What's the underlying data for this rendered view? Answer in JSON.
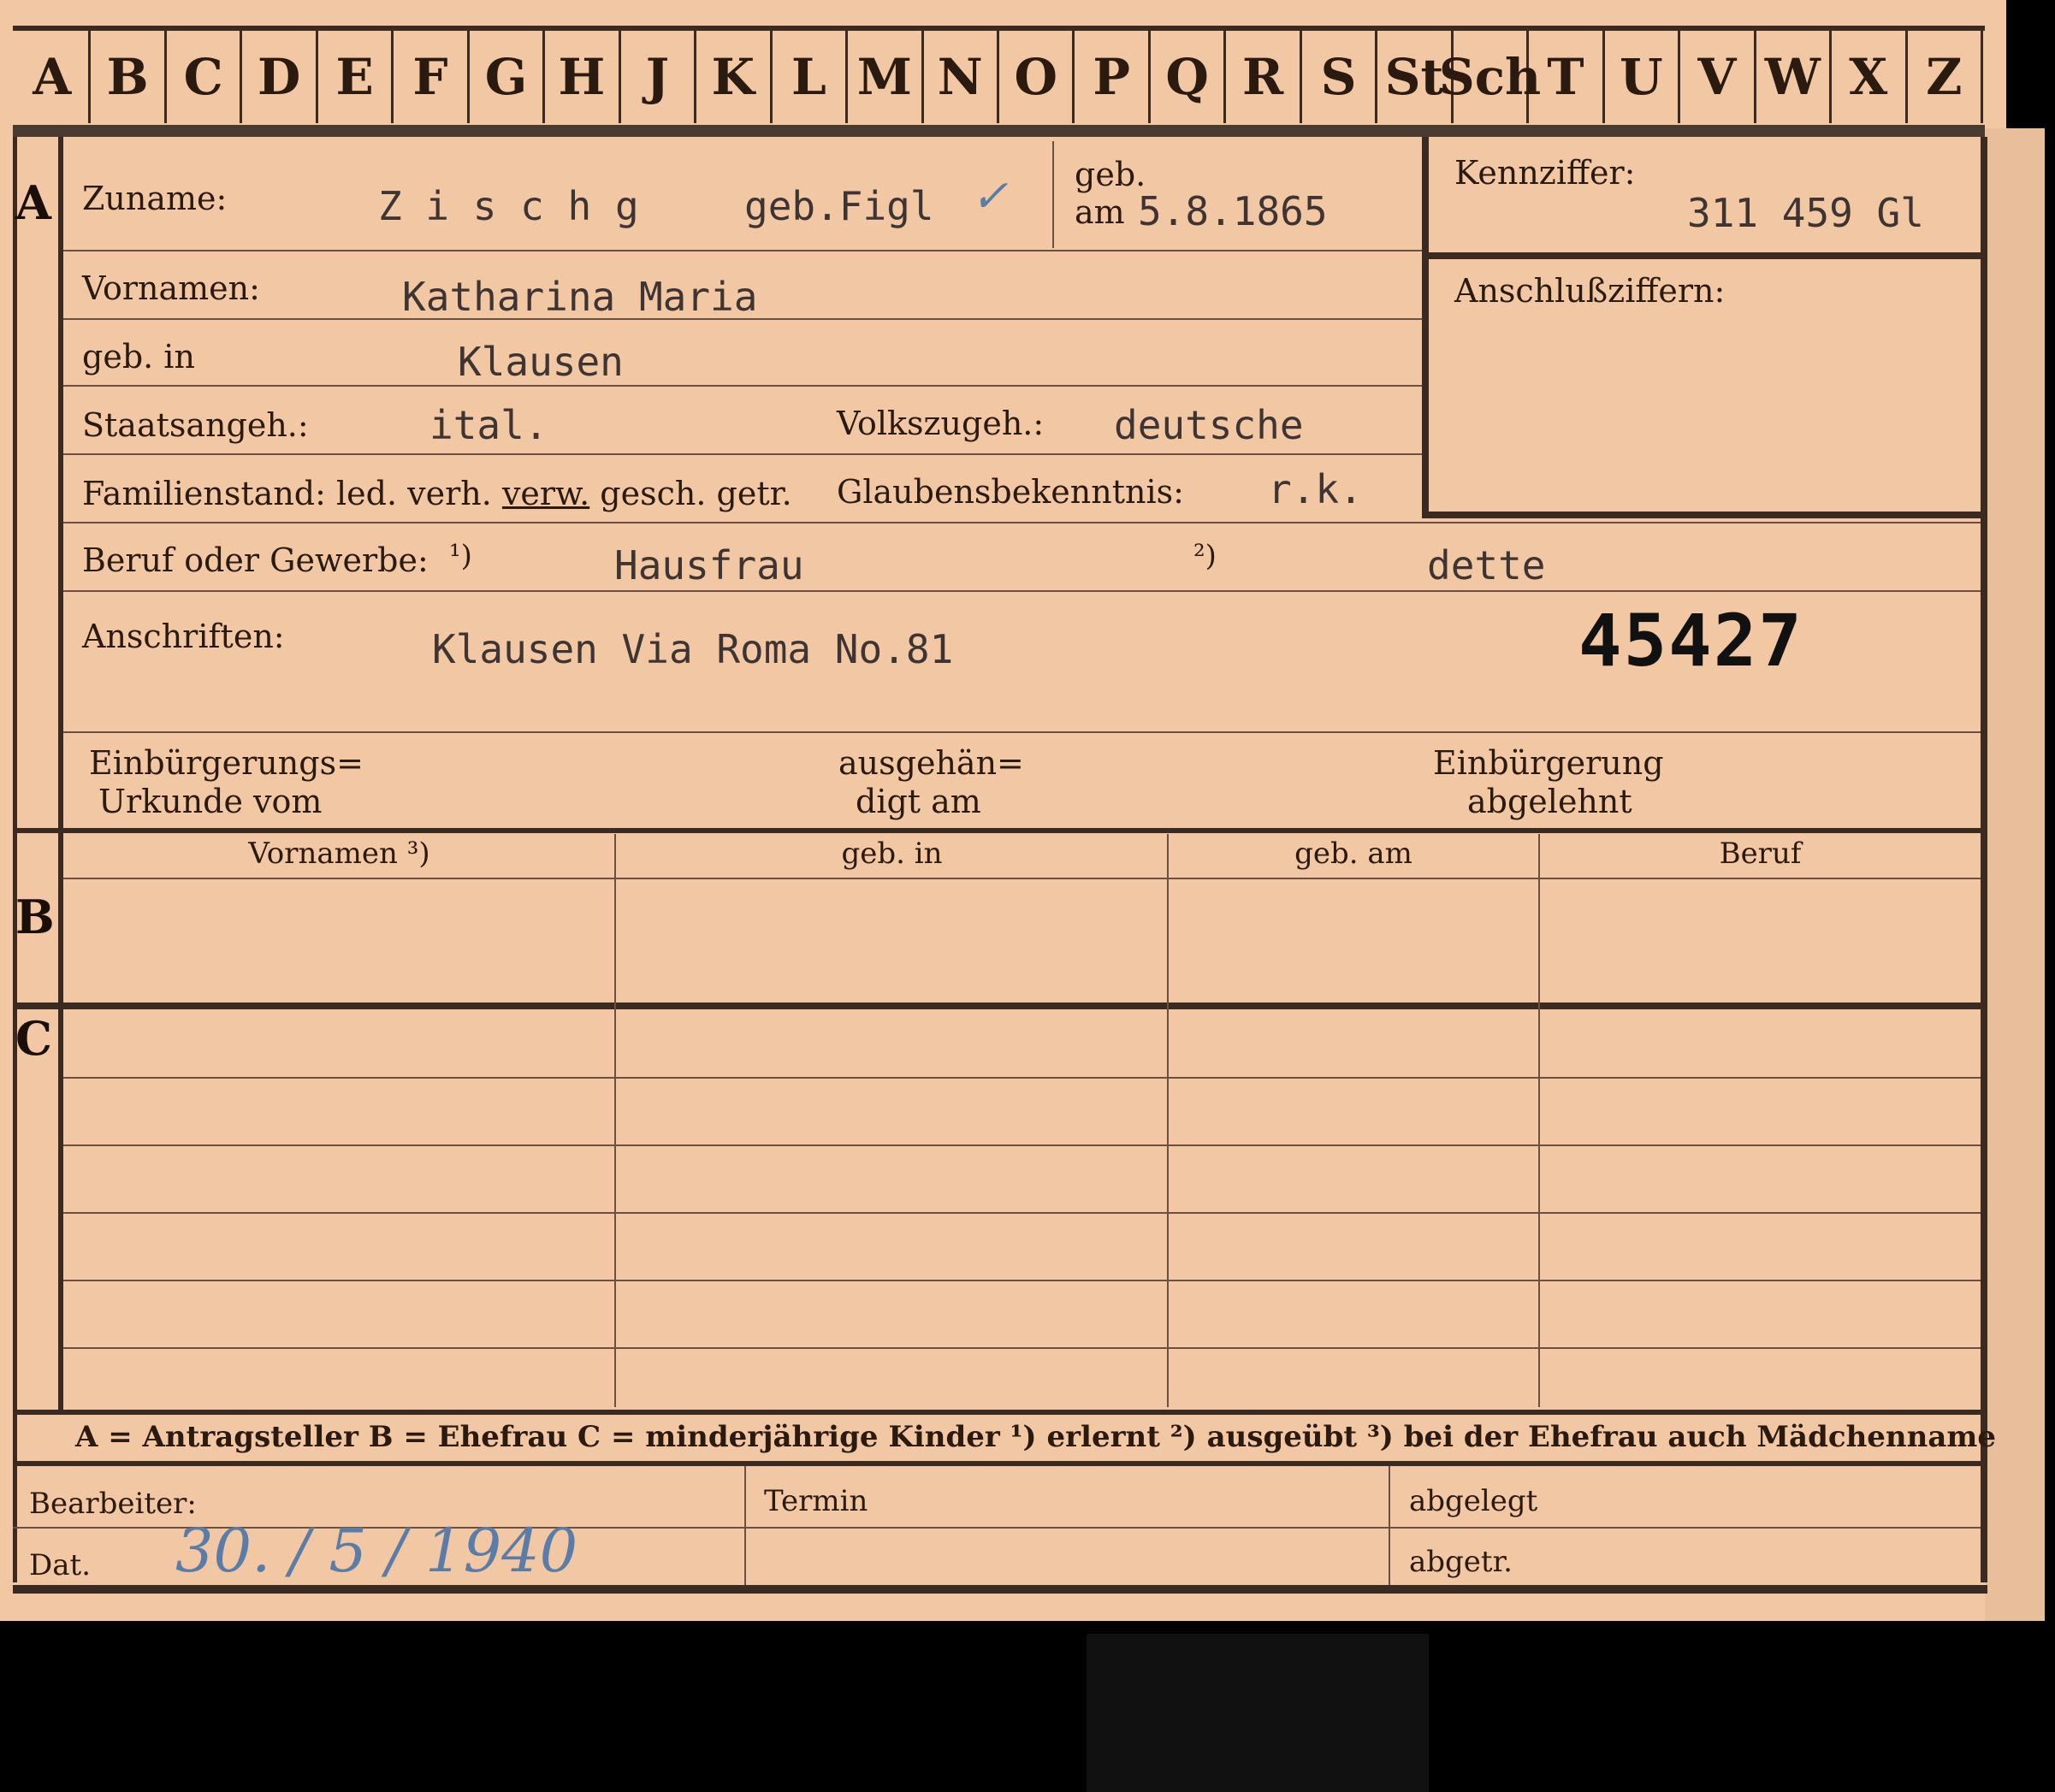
{
  "alphabet_tabs": [
    "A",
    "B",
    "C",
    "D",
    "E",
    "F",
    "G",
    "H",
    "J",
    "K",
    "L",
    "M",
    "N",
    "O",
    "P",
    "Q",
    "R",
    "S",
    "St",
    "Sch",
    "T",
    "U",
    "V",
    "W",
    "X",
    "Z"
  ],
  "sections": {
    "a": "A",
    "b": "B",
    "c": "C"
  },
  "labels": {
    "zuname": "Zuname:",
    "geb": "geb.",
    "am": "am",
    "kennziffer": "Kennziffer:",
    "anschlussziffern": "Anschlußziffern:",
    "vornamen": "Vornamen:",
    "geb_in": "geb. in",
    "staatsangeh": "Staatsangeh.:",
    "volkszugeh": "Volkszugeh.:",
    "familienstand": "Familienstand:",
    "fs_led": "led.",
    "fs_verh": "verh.",
    "fs_verw": "verw.",
    "fs_gesch": "gesch.",
    "fs_getr": "getr.",
    "glaubensbekenntnis": "Glaubensbekenntnis:",
    "beruf": "Beruf oder Gewerbe:",
    "note1": "¹)",
    "note2": "²)",
    "anschriften": "Anschriften:",
    "einb_urkunde_1": "Einbürgerungs=",
    "einb_urkunde_2": "Urkunde vom",
    "ausgeh_1": "ausgehän=",
    "ausgeh_2": "digt am",
    "einb_abgelehnt_1": "Einbürgerung",
    "einb_abgelehnt_2": "abgelehnt"
  },
  "values": {
    "zuname": "Z i s c h g",
    "geb_name": "geb.Figl",
    "geb_datum": "5.8.1865",
    "kennziffer": "311 459 Gl",
    "vornamen": "Katharina Maria",
    "geb_in": "Klausen",
    "staatsangeh": "ital.",
    "volkszugeh": "deutsche",
    "glaubensbekenntnis": "r.k.",
    "beruf_erlernt": "Hausfrau",
    "beruf_ausgeuebt": "dette",
    "anschrift": "Klausen Via Roma No.81",
    "stamp_number": "45427"
  },
  "table_headers": [
    "Vornamen ³)",
    "geb. in",
    "geb. am",
    "Beruf"
  ],
  "footer_legend": "A = Antragsteller   B = Ehefrau   C = minderjährige Kinder   ¹) erlernt   ²) ausgeübt   ³) bei der Ehefrau auch Mädchenname",
  "bottom": {
    "bearbeiter": "Bearbeiter:",
    "dat": "Dat.",
    "date_hand": "30. / 5 / 1940",
    "termin": "Termin",
    "abgelegt": "abgelegt",
    "abgetr": "abgetr."
  }
}
